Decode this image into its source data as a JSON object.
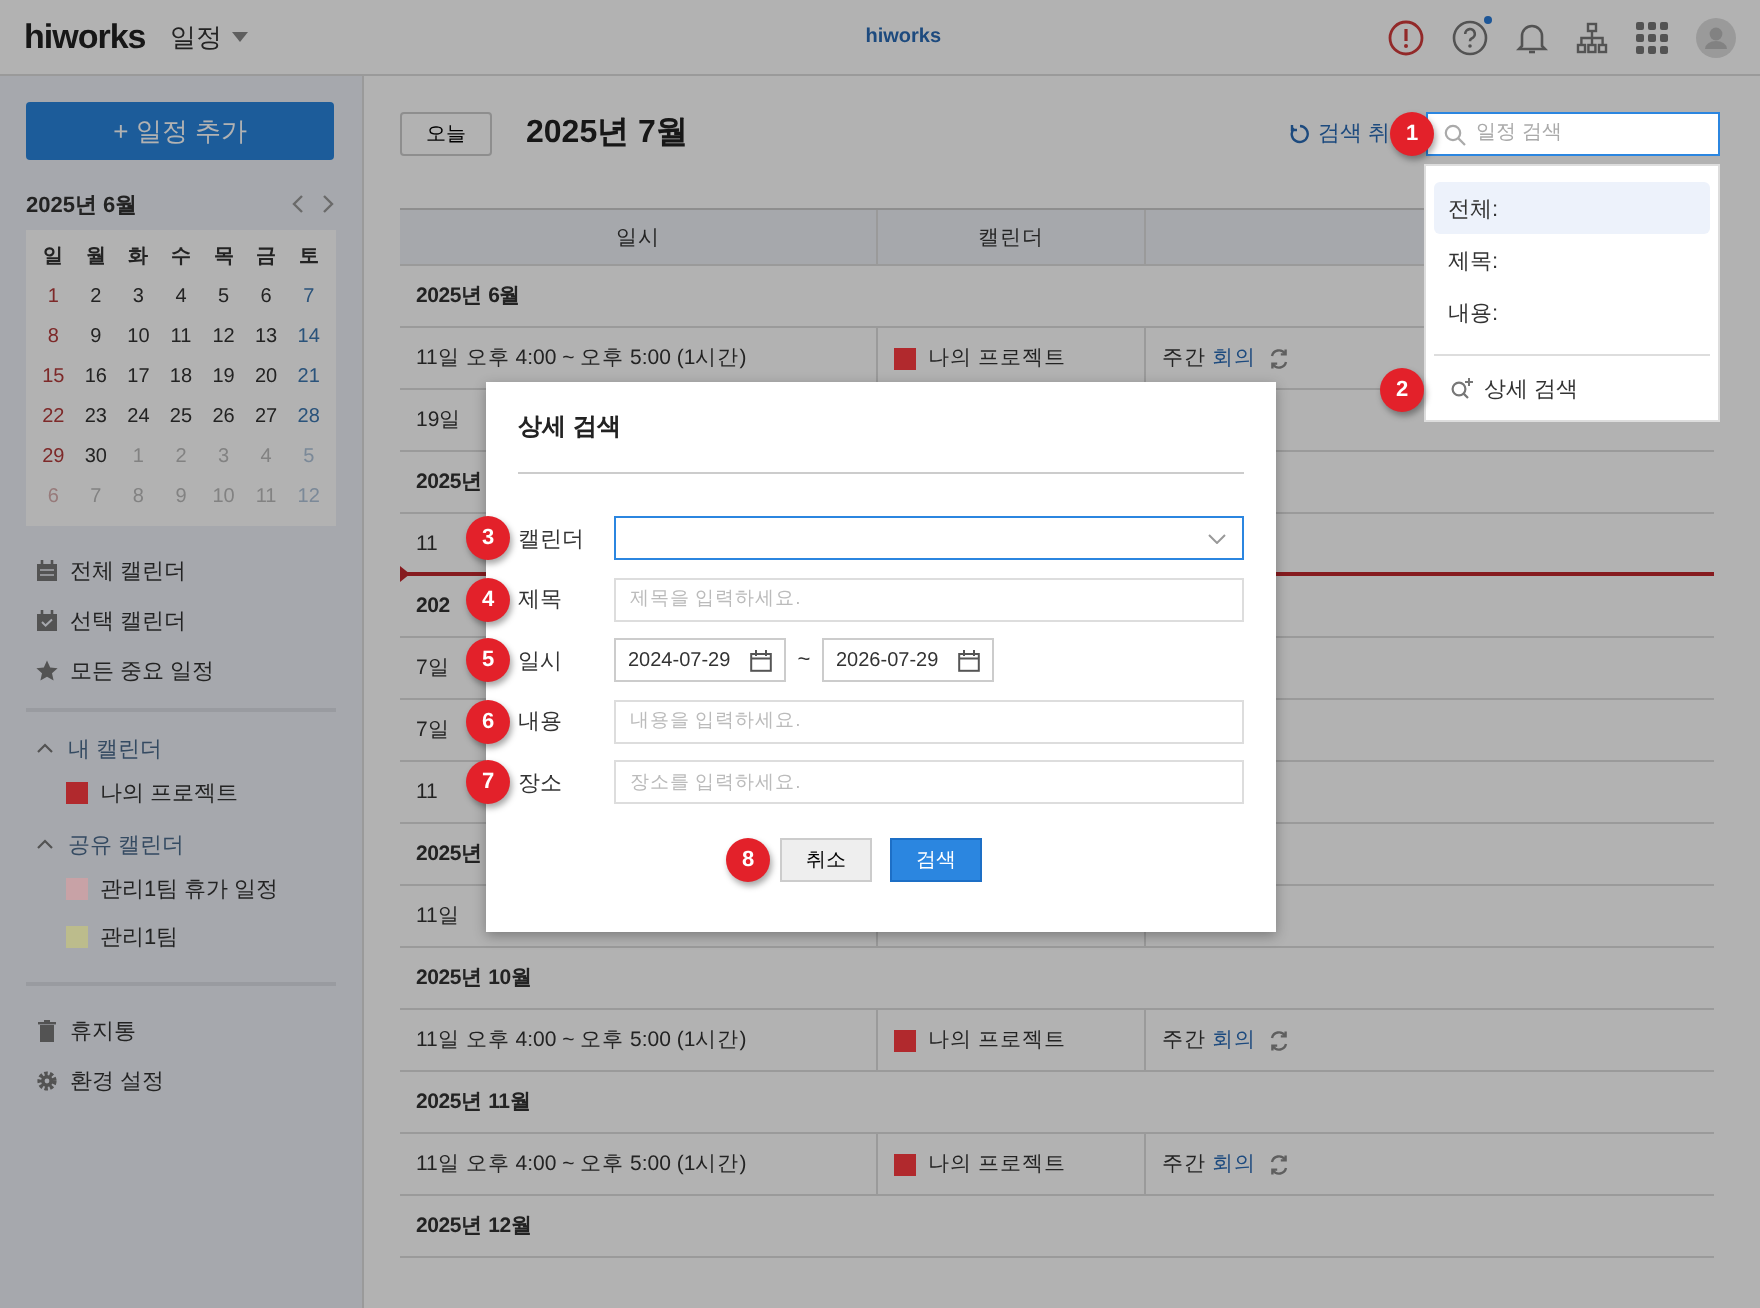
{
  "header": {
    "logo": "hiworks",
    "app_menu": "일정",
    "center_logo": "hiworks",
    "help_notification": true
  },
  "sidebar": {
    "add_button": "+ 일정 추가",
    "mini_calendar": {
      "title": "2025년 6월",
      "weekdays": [
        "일",
        "월",
        "화",
        "수",
        "목",
        "금",
        "토"
      ],
      "weeks": [
        [
          {
            "d": "1",
            "outside": false
          },
          {
            "d": "2",
            "outside": false
          },
          {
            "d": "3",
            "outside": false
          },
          {
            "d": "4",
            "outside": false
          },
          {
            "d": "5",
            "outside": false
          },
          {
            "d": "6",
            "outside": false
          },
          {
            "d": "7",
            "outside": false
          }
        ],
        [
          {
            "d": "8",
            "outside": false
          },
          {
            "d": "9",
            "outside": false
          },
          {
            "d": "10",
            "outside": false
          },
          {
            "d": "11",
            "outside": false
          },
          {
            "d": "12",
            "outside": false
          },
          {
            "d": "13",
            "outside": false
          },
          {
            "d": "14",
            "outside": false
          }
        ],
        [
          {
            "d": "15",
            "outside": false
          },
          {
            "d": "16",
            "outside": false
          },
          {
            "d": "17",
            "outside": false
          },
          {
            "d": "18",
            "outside": false
          },
          {
            "d": "19",
            "outside": false
          },
          {
            "d": "20",
            "outside": false
          },
          {
            "d": "21",
            "outside": false
          }
        ],
        [
          {
            "d": "22",
            "outside": false
          },
          {
            "d": "23",
            "outside": false
          },
          {
            "d": "24",
            "outside": false
          },
          {
            "d": "25",
            "outside": false
          },
          {
            "d": "26",
            "outside": false
          },
          {
            "d": "27",
            "outside": false
          },
          {
            "d": "28",
            "outside": false
          }
        ],
        [
          {
            "d": "29",
            "outside": false
          },
          {
            "d": "30",
            "outside": false
          },
          {
            "d": "1",
            "outside": true
          },
          {
            "d": "2",
            "outside": true
          },
          {
            "d": "3",
            "outside": true
          },
          {
            "d": "4",
            "outside": true
          },
          {
            "d": "5",
            "outside": true
          }
        ],
        [
          {
            "d": "6",
            "outside": true
          },
          {
            "d": "7",
            "outside": true
          },
          {
            "d": "8",
            "outside": true
          },
          {
            "d": "9",
            "outside": true
          },
          {
            "d": "10",
            "outside": true
          },
          {
            "d": "11",
            "outside": true
          },
          {
            "d": "12",
            "outside": true
          }
        ]
      ]
    },
    "menu": [
      {
        "kind": "all",
        "label": "전체 캘린더"
      },
      {
        "kind": "selected",
        "label": "선택 캘린더"
      },
      {
        "kind": "important",
        "label": "모든 중요 일정"
      }
    ],
    "sections": [
      {
        "title": "내 캘린더",
        "expanded": true,
        "items": [
          {
            "label": "나의 프로젝트",
            "color": "#b1292d"
          }
        ]
      },
      {
        "title": "공유 캘린더",
        "expanded": true,
        "items": [
          {
            "label": "관리1팀 휴가 일정",
            "color": "#c8a2a6"
          },
          {
            "label": "관리1팀",
            "color": "#bcbc8c"
          }
        ]
      }
    ],
    "footer_menu": [
      {
        "kind": "trash",
        "label": "휴지통"
      },
      {
        "kind": "settings",
        "label": "환경 설정"
      }
    ]
  },
  "toolbar": {
    "today_button": "오늘",
    "title": "2025년 7월",
    "cancel_search": "검색 취",
    "search": {
      "placeholder": "일정 검색",
      "badge": "1"
    }
  },
  "search_dropdown": {
    "options": [
      {
        "label": "전체:",
        "selected": true
      },
      {
        "label": "제목:",
        "selected": false
      },
      {
        "label": "내용:",
        "selected": false
      }
    ],
    "advanced": "상세 검색",
    "badge": "2"
  },
  "table": {
    "columns": [
      "일시",
      "캘린더"
    ],
    "rows": [
      {
        "kind": "group",
        "label": "2025년 6월"
      },
      {
        "kind": "event",
        "when": "11일 오후 4:00 ~ 오후 5:00 (1시간)",
        "calendar": {
          "name": "나의 프로젝트",
          "color": "#b1292d"
        },
        "title": "주간",
        "match": "회의",
        "repeat": true
      },
      {
        "kind": "event",
        "when": "19일"
      },
      {
        "kind": "group",
        "label": "2025년"
      },
      {
        "kind": "event",
        "when": "11"
      },
      {
        "kind": "group",
        "label": "202",
        "now_line": true
      },
      {
        "kind": "event",
        "when": "7일"
      },
      {
        "kind": "event",
        "when": "7일"
      },
      {
        "kind": "event",
        "when": "11"
      },
      {
        "kind": "group",
        "label": "2025년"
      },
      {
        "kind": "event",
        "when": "11일"
      },
      {
        "kind": "group",
        "label": "2025년 10월"
      },
      {
        "kind": "event",
        "when": "11일 오후 4:00 ~ 오후 5:00 (1시간)",
        "calendar": {
          "name": "나의 프로젝트",
          "color": "#b1292d"
        },
        "title": "주간",
        "match": "회의",
        "repeat": true
      },
      {
        "kind": "group",
        "label": "2025년 11월"
      },
      {
        "kind": "event",
        "when": "11일 오후 4:00 ~ 오후 5:00 (1시간)",
        "calendar": {
          "name": "나의 프로젝트",
          "color": "#b1292d"
        },
        "title": "주간",
        "match": "회의",
        "repeat": true
      },
      {
        "kind": "group",
        "label": "2025년 12월"
      }
    ]
  },
  "modal": {
    "title": "상세 검색",
    "fields": [
      {
        "kind": "select",
        "label": "캘린더",
        "badge": "3",
        "focused": true
      },
      {
        "kind": "text",
        "label": "제목",
        "badge": "4",
        "placeholder": "제목을 입력하세요."
      },
      {
        "kind": "daterange",
        "label": "일시",
        "badge": "5",
        "from": "2024-07-29",
        "separator": "~",
        "to": "2026-07-29"
      },
      {
        "kind": "text",
        "label": "내용",
        "badge": "6",
        "placeholder": "내용을 입력하세요."
      },
      {
        "kind": "text",
        "label": "장소",
        "badge": "7",
        "placeholder": "장소를 입력하세요."
      }
    ],
    "buttons_badge": "8",
    "buttons": [
      {
        "kind": "secondary",
        "label": "취소"
      },
      {
        "kind": "primary",
        "label": "검색"
      }
    ]
  }
}
